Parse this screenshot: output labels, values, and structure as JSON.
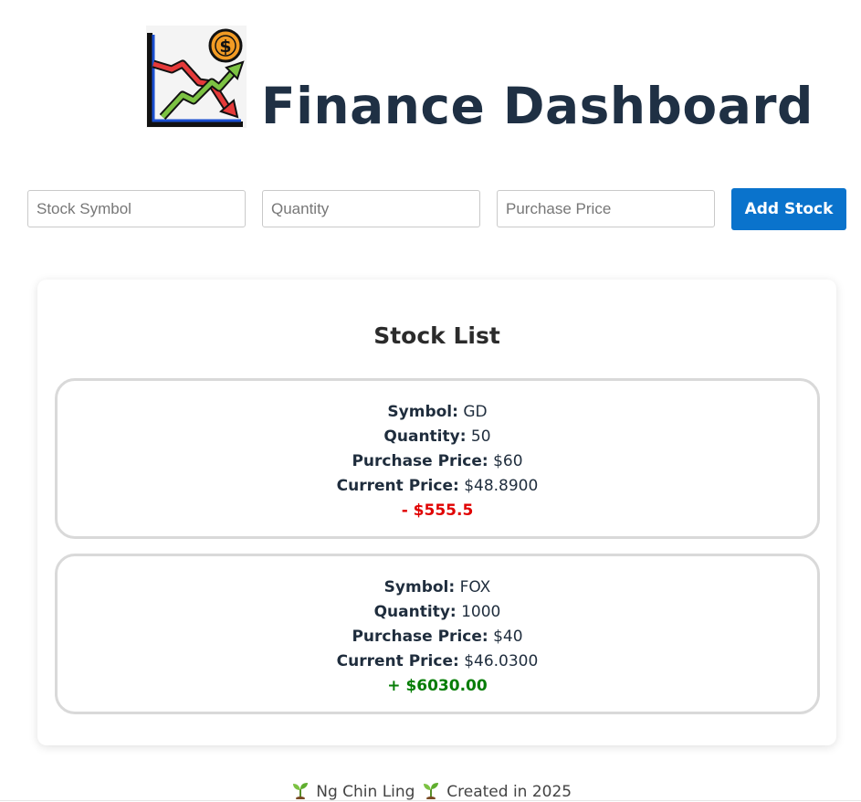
{
  "header": {
    "title": "Finance Dashboard",
    "logo_icon": "finance-chart-dollar-icon"
  },
  "form": {
    "symbol_placeholder": "Stock Symbol",
    "symbol_value": "",
    "quantity_placeholder": "Quantity",
    "quantity_value": "",
    "price_placeholder": "Purchase Price",
    "price_value": "",
    "add_button_label": "Add Stock"
  },
  "stock_list": {
    "title": "Stock List",
    "labels": {
      "symbol": "Symbol:",
      "quantity": "Quantity:",
      "purchase_price": "Purchase Price:",
      "current_price": "Current Price:"
    },
    "stocks": [
      {
        "symbol": "GD",
        "quantity": "50",
        "purchase_price": "$60",
        "current_price": "$48.8900",
        "profit_loss": "- $555.5",
        "status": "loss"
      },
      {
        "symbol": "FOX",
        "quantity": "1000",
        "purchase_price": "$40",
        "current_price": "$46.0300",
        "profit_loss": "+ $6030.00",
        "status": "gain"
      }
    ]
  },
  "footer": {
    "author": "Ng Chin Ling",
    "created": "Created in 2025",
    "icon": "sprout-icon"
  },
  "colors": {
    "accent": "#0a73cc",
    "title": "#1f3044",
    "loss": "#e00000",
    "gain": "#067d06"
  }
}
